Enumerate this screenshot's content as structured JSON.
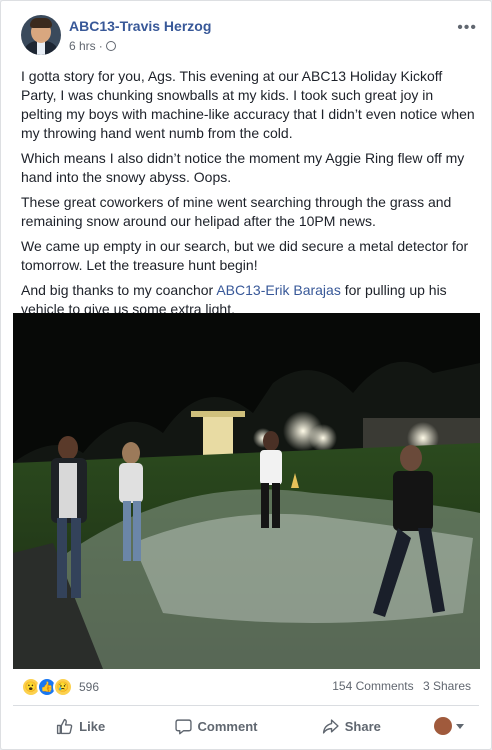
{
  "post": {
    "author": "ABC13-Travis Herzog",
    "time": "6 hrs",
    "separator": "·",
    "more_icon": "more-horizontal-icon",
    "paragraphs": [
      "I gotta story for you, Ags. This evening at our ABC13 Holiday Kickoff Party, I was chunking snowballs at my kids. I took such great joy in pelting my boys with machine-like accuracy that I didn’t even notice when my throwing hand went numb from the cold.",
      "Which means I also didn’t notice the moment my Aggie Ring flew off my hand into the snowy abyss. Oops.",
      "These great coworkers of mine went searching through the grass and remaining snow around our helipad after the 10PM news.",
      "We came up empty in our search, but we did secure a metal detector for tomorrow. Let the treasure hunt begin!"
    ],
    "last_paragraph": {
      "before": "And big thanks to my coanchor ",
      "link": "ABC13-Erik Barajas",
      "after": " for pulling up his vehicle to give us some extra light."
    }
  },
  "stats": {
    "reaction_count": "596",
    "comments": "154 Comments",
    "shares": "3 Shares",
    "reaction_icons": [
      "wow-reaction-icon",
      "like-reaction-icon",
      "sad-reaction-icon"
    ]
  },
  "actions": {
    "like": "Like",
    "comment": "Comment",
    "share": "Share"
  }
}
